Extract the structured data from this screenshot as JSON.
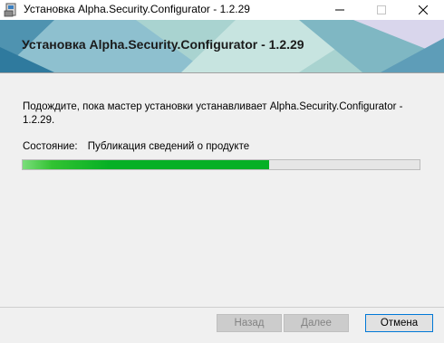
{
  "window": {
    "title": "Установка Alpha.Security.Configurator - 1.2.29",
    "controls": {
      "minimize": "—",
      "maximize": "☐",
      "close": "✕"
    },
    "icon": "installer-icon"
  },
  "banner": {
    "title": "Установка Alpha.Security.Configurator - 1.2.29"
  },
  "body": {
    "message": "Подождите, пока мастер установки устанавливает Alpha.Security.Configurator - 1.2.29.",
    "status_label": "Состояние:",
    "status_value": "Публикация сведений о продукте"
  },
  "progress": {
    "value": 0.62,
    "color": "#06b025"
  },
  "buttons": {
    "back": "Назад",
    "next": "Далее",
    "cancel": "Отмена"
  },
  "colors": {
    "banner_base": "#5f9fb8",
    "accent_focus": "#0078d7"
  }
}
